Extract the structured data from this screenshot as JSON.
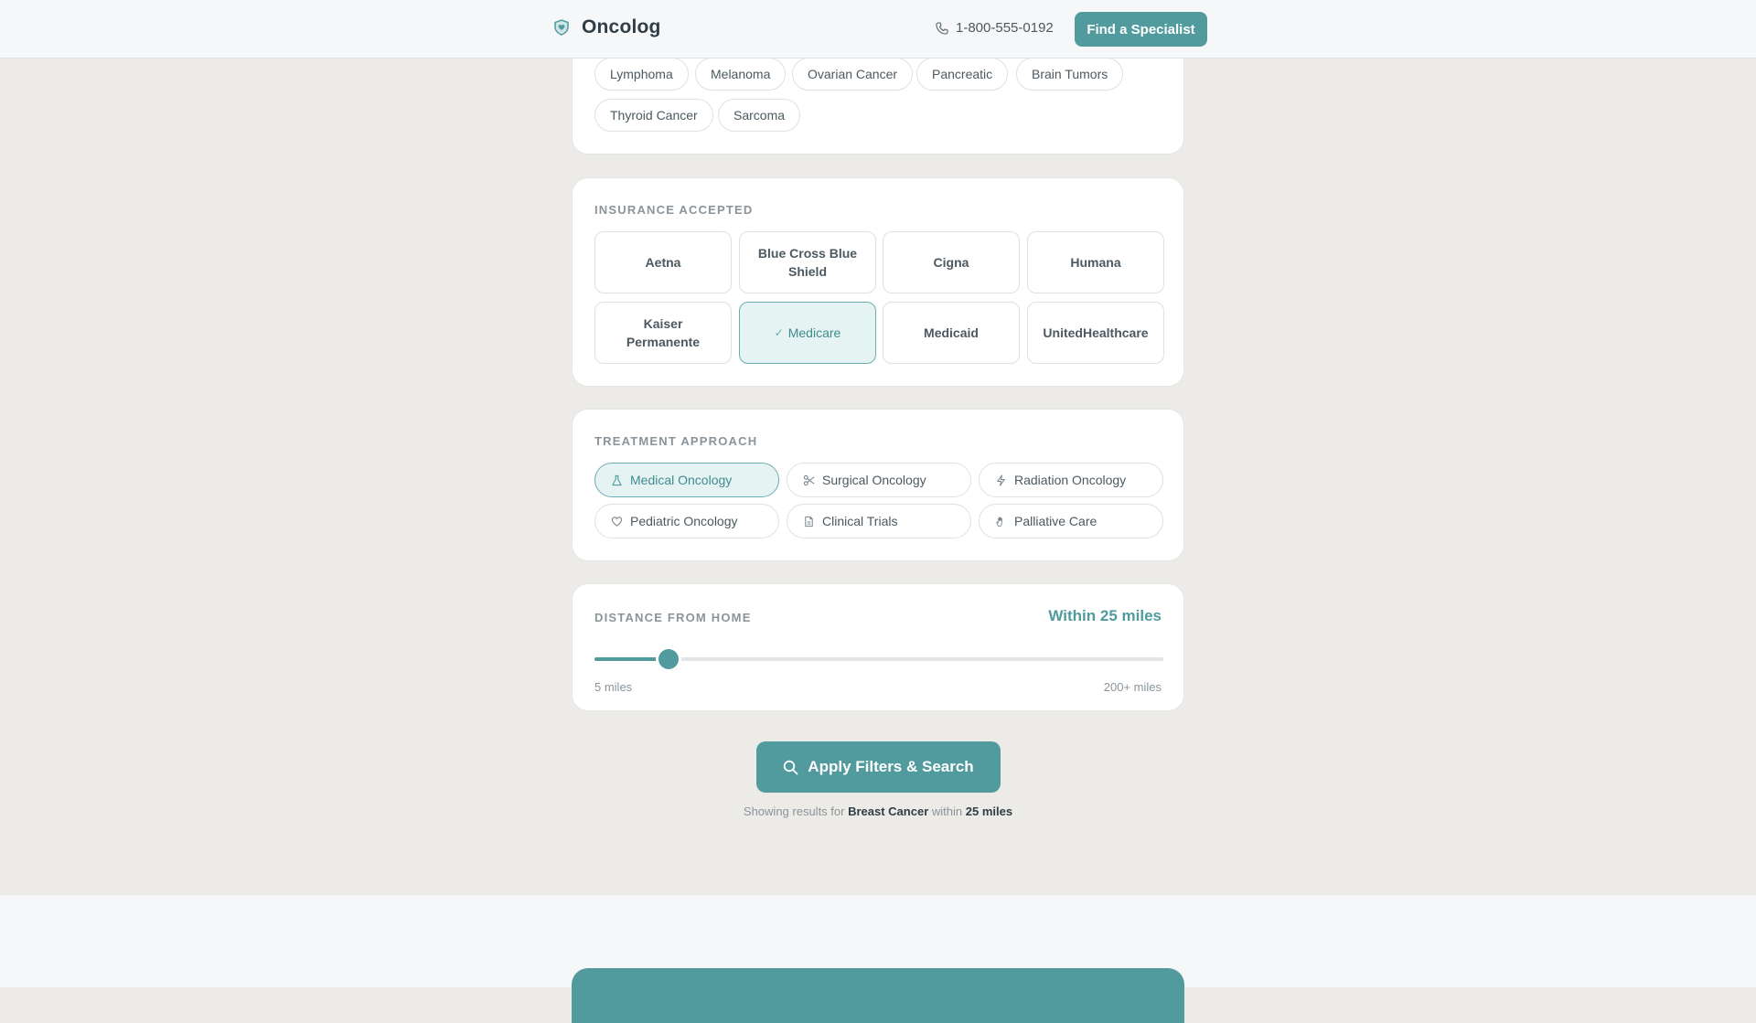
{
  "header": {
    "brand": "Oncolog",
    "phone": "1-800-555-0192",
    "cta_label": "Find a Specialist"
  },
  "cancer_types": {
    "items": [
      "Lymphoma",
      "Melanoma",
      "Ovarian Cancer",
      "Pancreatic",
      "Brain Tumors",
      "Thyroid Cancer",
      "Sarcoma"
    ]
  },
  "insurance": {
    "title": "INSURANCE ACCEPTED",
    "options": [
      {
        "label": "Aetna",
        "selected": false
      },
      {
        "label": "Blue Cross Blue Shield",
        "selected": false
      },
      {
        "label": "Cigna",
        "selected": false
      },
      {
        "label": "Humana",
        "selected": false
      },
      {
        "label": "Kaiser Permanente",
        "selected": false
      },
      {
        "label": "Medicare",
        "selected": true
      },
      {
        "label": "Medicaid",
        "selected": false
      },
      {
        "label": "UnitedHealthcare",
        "selected": false
      }
    ]
  },
  "treatment": {
    "title": "TREATMENT APPROACH",
    "options": [
      {
        "label": "Medical Oncology",
        "icon": "flask-icon",
        "selected": true
      },
      {
        "label": "Surgical Oncology",
        "icon": "scissors-icon",
        "selected": false
      },
      {
        "label": "Radiation Oncology",
        "icon": "sparkle-icon",
        "selected": false
      },
      {
        "label": "Pediatric Oncology",
        "icon": "heart-icon",
        "selected": false
      },
      {
        "label": "Clinical Trials",
        "icon": "document-icon",
        "selected": false
      },
      {
        "label": "Palliative Care",
        "icon": "hand-icon",
        "selected": false
      }
    ]
  },
  "distance": {
    "title": "DISTANCE FROM HOME",
    "value_label": "Within 25 miles",
    "min_label": "5 miles",
    "max_label": "200+ miles",
    "min": 5,
    "max": 200,
    "value": 25
  },
  "apply": {
    "label": "Apply Filters & Search"
  },
  "summary": {
    "prefix": "Showing results for",
    "condition": "Breast Cancer",
    "middle": "within",
    "distance": "25 miles"
  },
  "colors": {
    "accent": "#519a9e",
    "page_bg": "#edebe7"
  }
}
